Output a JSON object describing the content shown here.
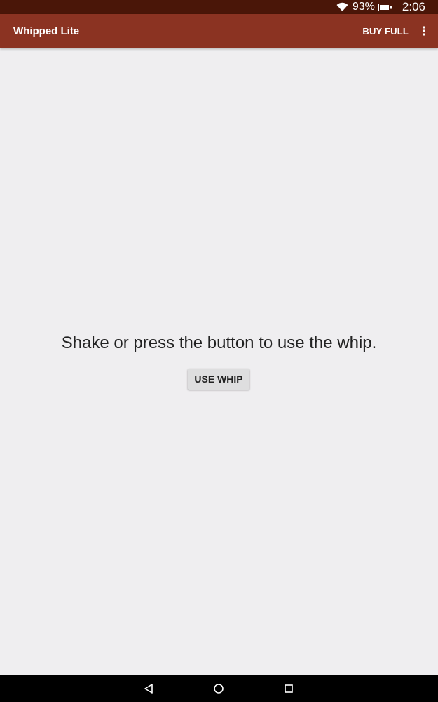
{
  "status_bar": {
    "battery_percent": "93%",
    "time": "2:06",
    "icons": [
      "wifi-icon",
      "battery-icon"
    ]
  },
  "app_bar": {
    "title": "Whipped Lite",
    "action_label": "BUY FULL",
    "overflow_icon": "more-vert-icon"
  },
  "main": {
    "instruction": "Shake or press the button to use the whip.",
    "button_label": "USE WHIP"
  },
  "nav_bar": {
    "icons": [
      "back-icon",
      "home-icon",
      "recents-icon"
    ]
  },
  "colors": {
    "status_bar": "#4a1608",
    "app_bar": "#8b3322",
    "background": "#efeef0",
    "button": "#dededf",
    "nav_bar": "#000000"
  }
}
